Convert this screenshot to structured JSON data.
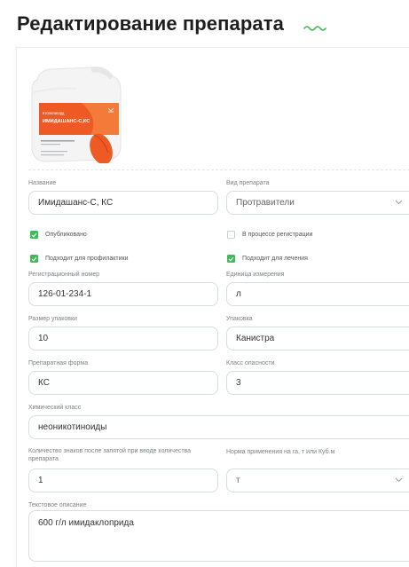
{
  "page": {
    "title": "Редактирование препарата"
  },
  "product": {
    "image_icon": "product-canister",
    "label_brand": "Ктополигард",
    "label_name": "ИМИДАШАНС-С,КС"
  },
  "form": {
    "name": {
      "label": "Название",
      "value": "Имидашанс-С, КС"
    },
    "type": {
      "label": "Вид препарата",
      "value": "Протравители"
    },
    "published": {
      "label": "Опубликовано",
      "checked": true
    },
    "in_registration": {
      "label": "В процессе регистрации",
      "checked": false
    },
    "prevention": {
      "label": "Подходит для профилактики",
      "checked": true
    },
    "treatment": {
      "label": "Подходит для лечения",
      "checked": true
    },
    "reg_number": {
      "label": "Регистрационный номер",
      "value": "126-01-234-1"
    },
    "unit": {
      "label": "Единица измерения",
      "value": "л"
    },
    "pack_size": {
      "label": "Размер упаковки",
      "value": "10"
    },
    "packaging": {
      "label": "Упаковка",
      "value": "Канистра"
    },
    "form_type": {
      "label": "Препаратная форма",
      "value": "КС"
    },
    "hazard": {
      "label": "Класс опасности",
      "value": "3"
    },
    "chem_class": {
      "label": "Химический класс",
      "value": "неоникотиноиды"
    },
    "decimals": {
      "label": "Количество знаков после запятой при вводе количества препарата",
      "value": "1"
    },
    "rate_unit": {
      "label": "Норма применения на га, т или Куб.м",
      "value": "т"
    },
    "description": {
      "label": "Текстовое описание",
      "value": "600 г/л имидаклоприда"
    }
  },
  "colors": {
    "accent_green": "#3dbb57",
    "border": "#d7dde1",
    "label": "#7a8288"
  }
}
